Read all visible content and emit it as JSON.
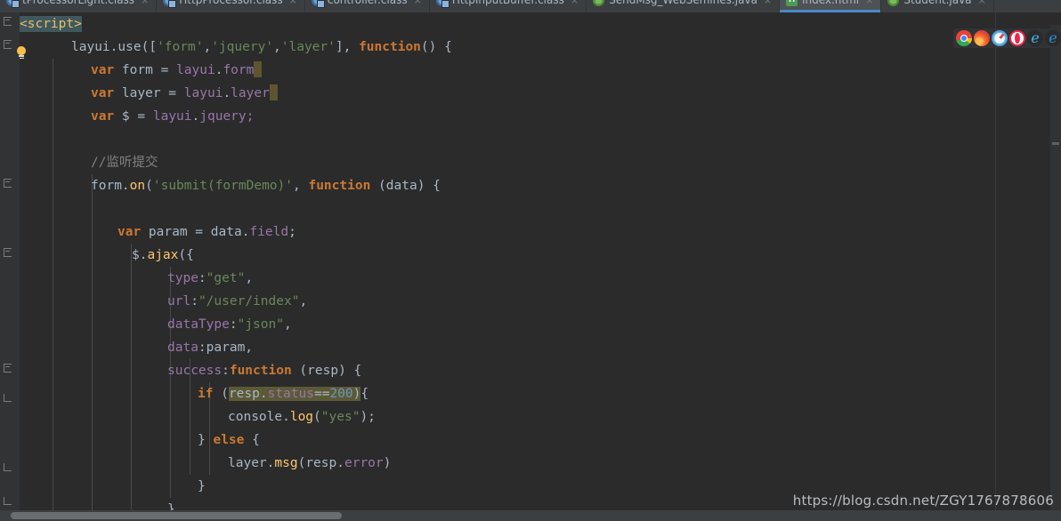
{
  "window": {
    "theme_bg": "#2b2b2b",
    "gutter_bg": "#313335",
    "accent": "#4a88c7"
  },
  "tabs": [
    {
      "label": "tProcessorLight.class",
      "icon": "java-class-icon",
      "active": false,
      "close": "×"
    },
    {
      "label": "HttpProcessor.class",
      "icon": "java-class-icon",
      "active": false,
      "close": "×"
    },
    {
      "label": "controller.class",
      "icon": "java-class-icon",
      "active": false,
      "close": "×"
    },
    {
      "label": "HttpInputBuffer.class",
      "icon": "java-class-icon",
      "active": false,
      "close": "×"
    },
    {
      "label": "SendMsg_WebSemines.java",
      "icon": "java-file-icon",
      "active": false,
      "close": "×"
    },
    {
      "label": "index.html",
      "icon": "html-file-icon",
      "icon_letter": "H",
      "active": true,
      "close": "×"
    },
    {
      "label": "Student.java",
      "icon": "java-file-icon",
      "active": false,
      "close": "×"
    }
  ],
  "browsers": [
    {
      "name": "chrome-icon",
      "glyph": ""
    },
    {
      "name": "firefox-icon",
      "glyph": ""
    },
    {
      "name": "safari-icon",
      "glyph": ""
    },
    {
      "name": "opera-icon",
      "glyph": ""
    },
    {
      "name": "edge-icon",
      "glyph": "e"
    },
    {
      "name": "internet-explorer-icon",
      "glyph": "e"
    }
  ],
  "editor": {
    "language": "html-javascript",
    "intention_bulb": "lightbulb-icon",
    "selection_text": "resp.status==200",
    "code_lines": [
      {
        "tokens": [
          {
            "t": "<script>",
            "c": "script-hl"
          }
        ]
      },
      {
        "tokens": [
          {
            "t": "layui",
            "c": "ident"
          },
          {
            "t": ".",
            "c": "punct"
          },
          {
            "t": "use",
            "c": "ident"
          },
          {
            "t": "([",
            "c": "punct"
          },
          {
            "t": "'form'",
            "c": "str"
          },
          {
            "t": ",",
            "c": "punct"
          },
          {
            "t": "'jquery'",
            "c": "str"
          },
          {
            "t": ",",
            "c": "punct"
          },
          {
            "t": "'layer'",
            "c": "str"
          },
          {
            "t": "], ",
            "c": "punct"
          },
          {
            "t": "function",
            "c": "kw"
          },
          {
            "t": "() {",
            "c": "punct"
          }
        ]
      },
      {
        "tokens": [
          {
            "t": "var",
            "c": "kw"
          },
          {
            "t": " form = ",
            "c": "ident"
          },
          {
            "t": "layui",
            "c": "field"
          },
          {
            "t": ".",
            "c": "punct"
          },
          {
            "t": "form",
            "c": "field"
          }
        ]
      },
      {
        "tokens": [
          {
            "t": "var",
            "c": "kw"
          },
          {
            "t": " layer = ",
            "c": "ident"
          },
          {
            "t": "layui",
            "c": "field"
          },
          {
            "t": ".",
            "c": "punct"
          },
          {
            "t": "layer",
            "c": "field"
          }
        ]
      },
      {
        "tokens": [
          {
            "t": "var",
            "c": "kw"
          },
          {
            "t": " $ = ",
            "c": "ident"
          },
          {
            "t": "layui",
            "c": "field"
          },
          {
            "t": ".",
            "c": "punct"
          },
          {
            "t": "jquery;",
            "c": "field"
          }
        ]
      },
      {
        "tokens": []
      },
      {
        "tokens": [
          {
            "t": "//监听提交",
            "c": "comment"
          }
        ]
      },
      {
        "tokens": [
          {
            "t": "form",
            "c": "ident"
          },
          {
            "t": ".",
            "c": "punct"
          },
          {
            "t": "on",
            "c": "fn"
          },
          {
            "t": "(",
            "c": "punct"
          },
          {
            "t": "'submit(formDemo)'",
            "c": "str"
          },
          {
            "t": ", ",
            "c": "punct"
          },
          {
            "t": "function",
            "c": "kw"
          },
          {
            "t": " (data) {",
            "c": "punct"
          }
        ]
      },
      {
        "tokens": []
      },
      {
        "tokens": [
          {
            "t": "var",
            "c": "kw"
          },
          {
            "t": " param = data.",
            "c": "ident"
          },
          {
            "t": "field",
            "c": "field"
          },
          {
            "t": ";",
            "c": "punct"
          }
        ]
      },
      {
        "tokens": [
          {
            "t": "$",
            "c": "ident"
          },
          {
            "t": ".",
            "c": "punct"
          },
          {
            "t": "ajax",
            "c": "fn"
          },
          {
            "t": "({",
            "c": "punct"
          }
        ]
      },
      {
        "tokens": [
          {
            "t": "type",
            "c": "field"
          },
          {
            "t": ":",
            "c": "punct"
          },
          {
            "t": "\"get\"",
            "c": "str"
          },
          {
            "t": ",",
            "c": "punct"
          }
        ]
      },
      {
        "tokens": [
          {
            "t": "url",
            "c": "field"
          },
          {
            "t": ":",
            "c": "punct"
          },
          {
            "t": "\"/user/index\"",
            "c": "str"
          },
          {
            "t": ",",
            "c": "punct"
          }
        ]
      },
      {
        "tokens": [
          {
            "t": "dataType",
            "c": "field"
          },
          {
            "t": ":",
            "c": "punct"
          },
          {
            "t": "\"json\"",
            "c": "str"
          },
          {
            "t": ",",
            "c": "punct"
          }
        ]
      },
      {
        "tokens": [
          {
            "t": "data",
            "c": "field"
          },
          {
            "t": ":param,",
            "c": "punct"
          }
        ]
      },
      {
        "tokens": [
          {
            "t": "success",
            "c": "field"
          },
          {
            "t": ":",
            "c": "punct"
          },
          {
            "t": "function",
            "c": "kw"
          },
          {
            "t": " (resp) {",
            "c": "punct"
          }
        ]
      },
      {
        "tokens": [
          {
            "t": "if",
            "c": "kw"
          },
          {
            "t": " (",
            "c": "punct"
          },
          {
            "t": "SEL",
            "c": "sel"
          },
          {
            "t": "{",
            "c": "punct"
          }
        ]
      },
      {
        "tokens": [
          {
            "t": "console",
            "c": "ident"
          },
          {
            "t": ".",
            "c": "punct"
          },
          {
            "t": "log",
            "c": "fn"
          },
          {
            "t": "(",
            "c": "punct"
          },
          {
            "t": "\"yes\"",
            "c": "str"
          },
          {
            "t": ");",
            "c": "punct"
          }
        ]
      },
      {
        "tokens": [
          {
            "t": "} ",
            "c": "punct"
          },
          {
            "t": "else",
            "c": "kw"
          },
          {
            "t": " {",
            "c": "punct"
          }
        ]
      },
      {
        "tokens": [
          {
            "t": "layer",
            "c": "ident"
          },
          {
            "t": ".",
            "c": "punct"
          },
          {
            "t": "msg",
            "c": "fn"
          },
          {
            "t": "(resp.",
            "c": "punct"
          },
          {
            "t": "error",
            "c": "field"
          },
          {
            "t": ")",
            "c": "punct"
          }
        ]
      },
      {
        "tokens": [
          {
            "t": "}",
            "c": "punct"
          }
        ]
      },
      {
        "tokens": [
          {
            "t": "}",
            "c": "punct"
          }
        ]
      }
    ]
  },
  "watermark": {
    "text": "https://blog.csdn.net/ZGY1767878606"
  }
}
